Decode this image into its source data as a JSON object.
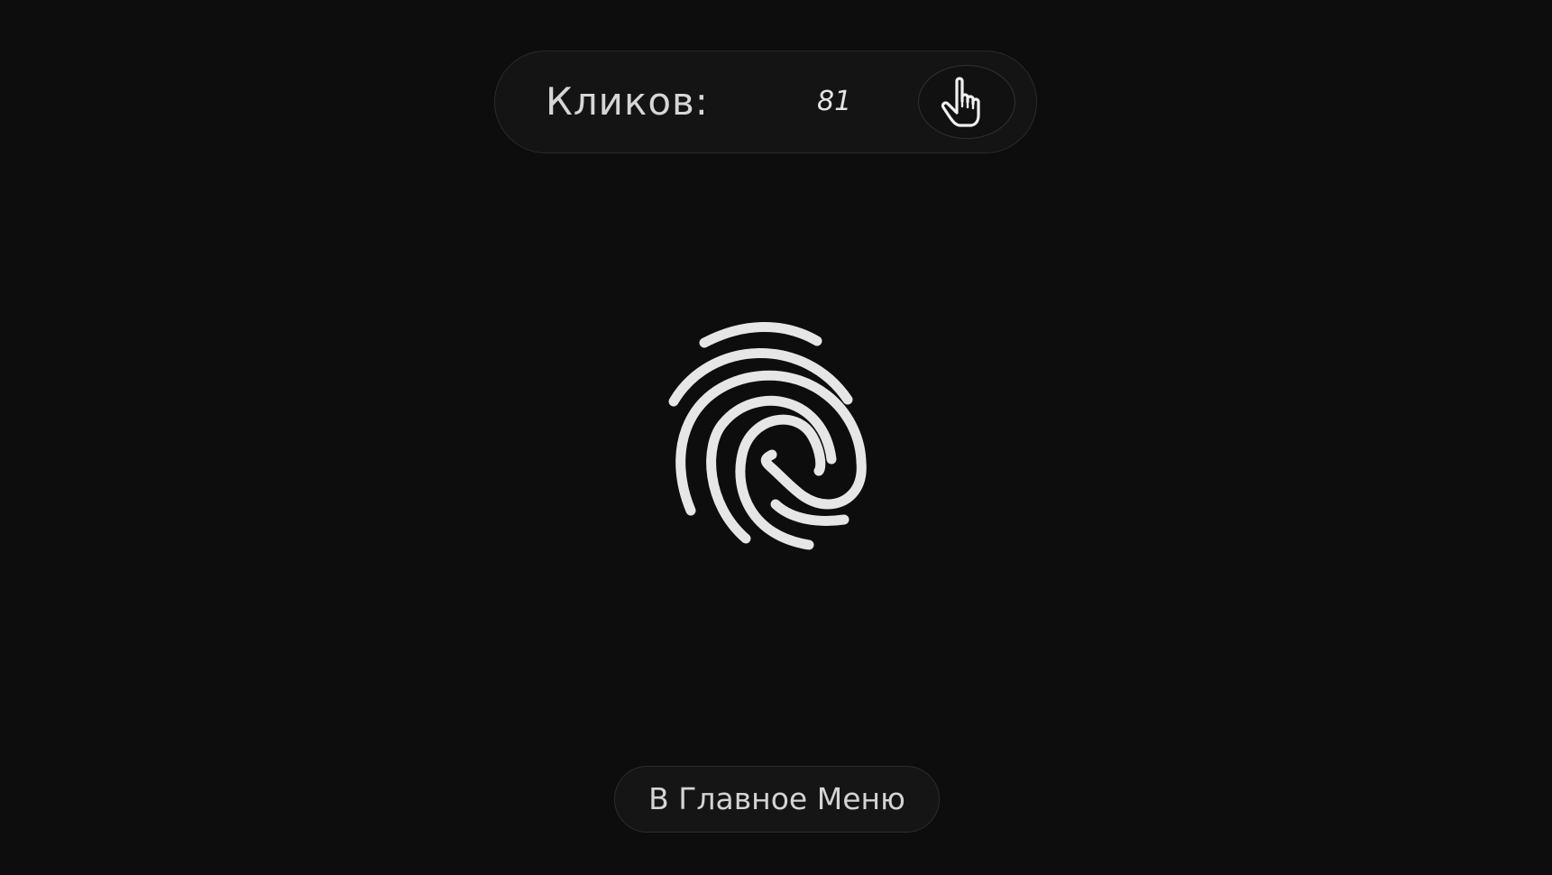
{
  "counter": {
    "label": "Кликов:",
    "value": "81",
    "button_icon": "hand-pointer-icon"
  },
  "main": {
    "icon": "fingerprint-icon"
  },
  "footer": {
    "menu_button_label": "В Главное Меню"
  }
}
